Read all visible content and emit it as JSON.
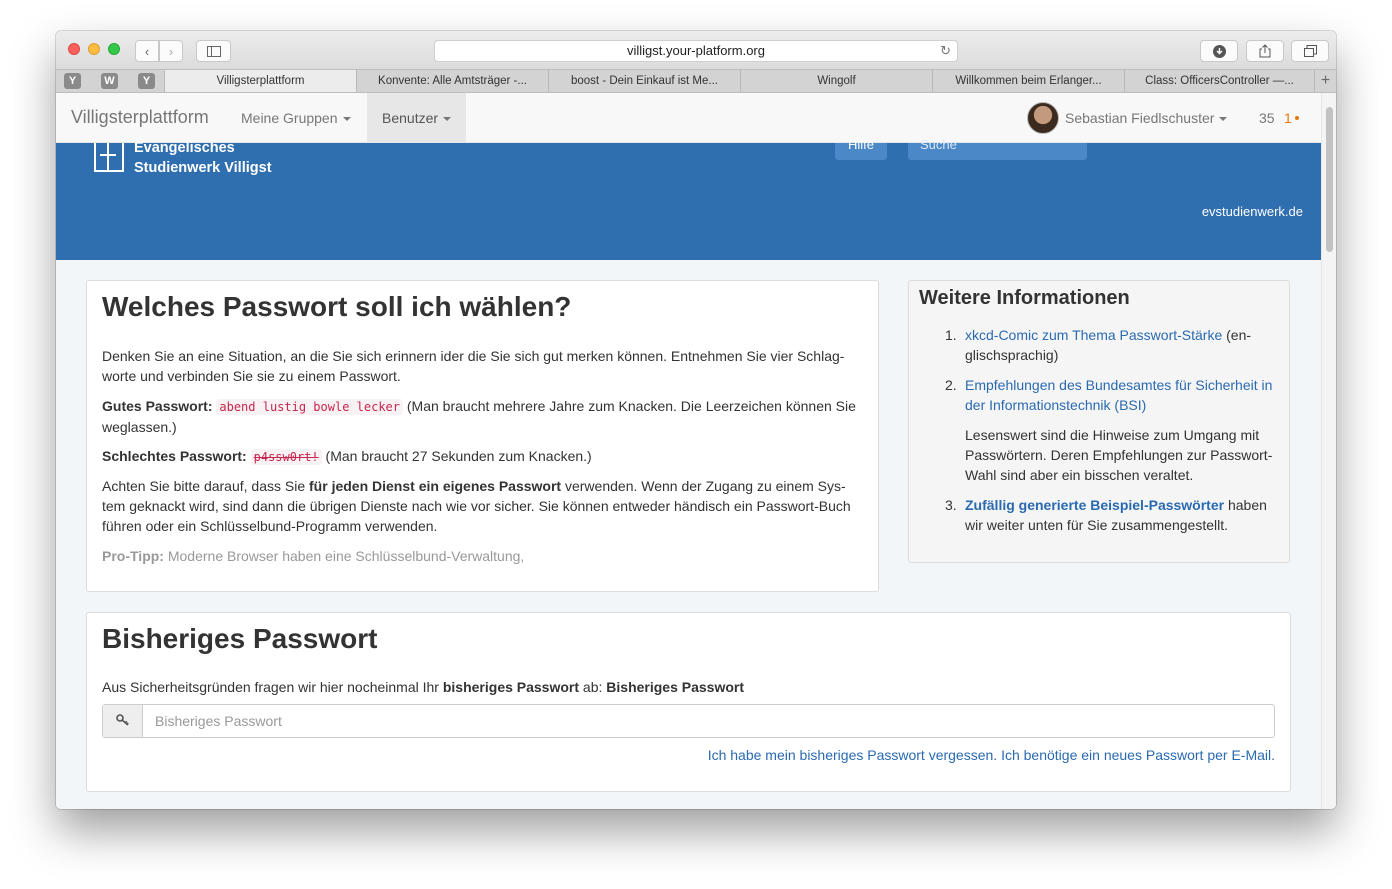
{
  "browser": {
    "url": "villigst.your-platform.org",
    "pinned_tabs": [
      "Y",
      "W",
      "Y"
    ],
    "tabs": [
      "Villigsterplattform",
      "Konvente: Alle Amtsträger -...",
      "boost - Dein Einkauf ist Me...",
      "Wingolf",
      "Willkommen beim Erlanger...",
      "Class: OfficersController —..."
    ]
  },
  "navbar": {
    "brand": "Villigsterplattform",
    "groups": "Meine Gruppen",
    "users": "Benutzer",
    "user_name": "Sebastian Fiedlschuster",
    "notification_count": "35",
    "notification_new": "1"
  },
  "header": {
    "logo_line1": "Evangelisches",
    "logo_line2": "Studienwerk Villigst",
    "help": "Hilfe",
    "search_placeholder": "Suche",
    "site_link": "evstudienwerk.de"
  },
  "password_choice": {
    "title": "Welches Passwort soll ich wählen?",
    "intro": "Denken Sie an eine Situation, an die Sie sich erinnern ider die Sie sich gut merken können. Entnehmen Sie vier Schlag-worte und verbinden Sie sie zu einem Passwort.",
    "good_label": "Gutes Passwort:",
    "good_example": "abend lustig bowle lecker",
    "good_note": "(Man braucht mehrere Jahre zum Knacken. Die Leerzeichen können Sie weglassen.)",
    "bad_label": "Schlechtes Passwort:",
    "bad_example": "p4ssw0rt!",
    "bad_note": "(Man braucht 27 Sekunden zum Knacken.)",
    "advice_pre": "Achten Sie bitte darauf, dass Sie",
    "advice_bold": "für jeden Dienst ein eigenes Passwort",
    "advice_post": "verwenden. Wenn der Zugang zu einem Sys-tem geknackt wird, sind dann die übrigen Dienste nach wie vor sicher. Sie können entweder händisch ein Passwort-Buch führen oder ein Schlüsselbund-Programm verwenden.",
    "tip_label": "Pro-Tipp:",
    "tip_text": "Moderne Browser haben eine Schlüsselbund-Verwaltung,"
  },
  "more_info": {
    "title": "Weitere Informationen",
    "item1_num": "1.",
    "item1_link": "xkcd-Comic zum Thema Passwort-Stärke",
    "item1_suffix": "(en-glischsprachig)",
    "item2_num": "2.",
    "item2_link": "Empfehlungen des Bundesamtes für Sicherheit in der Informationstechnik (BSI)",
    "item2_note": "Lesenswert sind die Hinweise zum Umgang mit Passwörtern. Deren Empfehlungen zur Passwort-Wahl sind aber ein bisschen veraltet.",
    "item3_num": "3.",
    "item3_link": "Zufällig generierte Beispiel-Passwörter",
    "item3_suffix": "haben wir weiter unten für Sie zusammengestellt."
  },
  "old_password": {
    "title": "Bisheriges Passwort",
    "label_pre": "Aus Sicherheitsgründen fragen wir hier nocheinmal Ihr",
    "label_bold": "bisheriges Passwort",
    "label_mid": "ab:",
    "label_field": "Bisheriges Passwort",
    "placeholder": "Bisheriges Passwort",
    "forgot_link": "Ich habe mein bisheriges Passwort vergessen. Ich benötige ein neues Passwort per E-Mail."
  },
  "colors": {
    "header_blue": "#2f6eaf",
    "link": "#2a6ab1",
    "code": "#c7254e",
    "notification": "#e8780e"
  },
  "icons": {
    "back": "chevron-left-icon",
    "forward": "chevron-right-icon",
    "sidebar": "sidebar-icon",
    "reload": "reload-icon",
    "download": "download-icon",
    "share": "share-icon",
    "tabs": "tabs-icon",
    "key": "key-icon"
  }
}
